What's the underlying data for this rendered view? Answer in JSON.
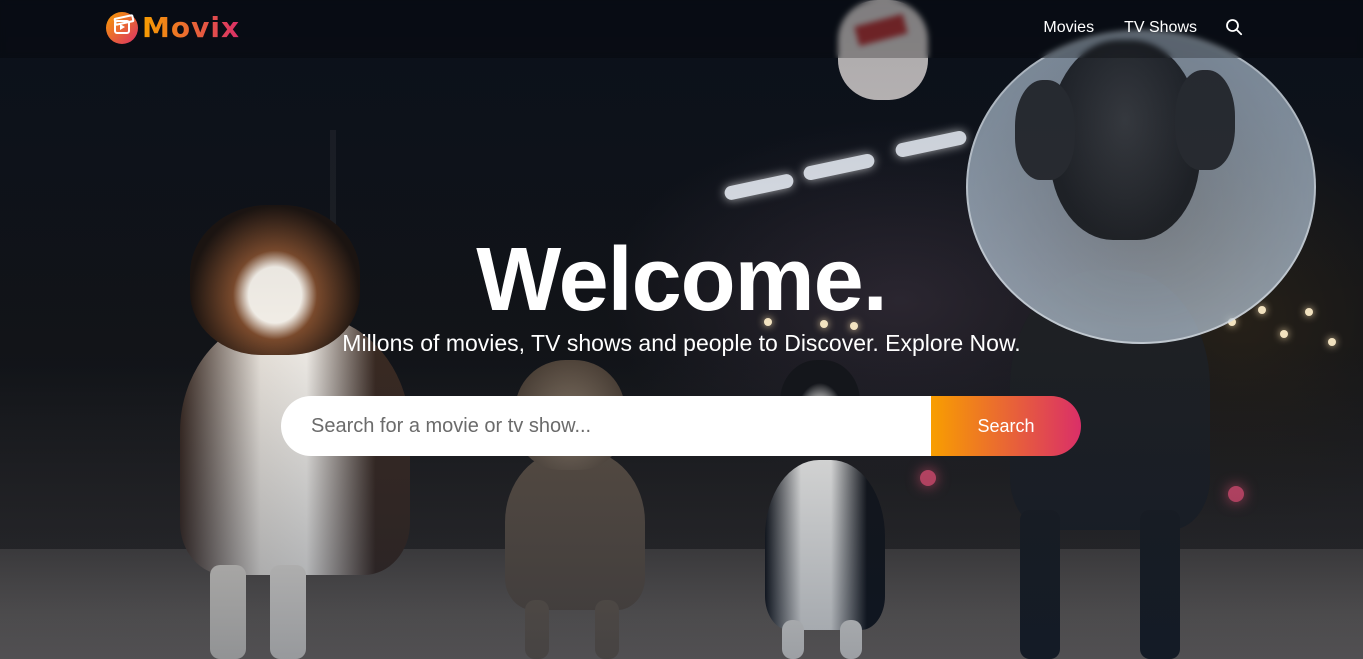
{
  "app": {
    "logo_text": "Movix"
  },
  "header": {
    "nav": [
      {
        "label": "Movies"
      },
      {
        "label": "TV Shows"
      }
    ]
  },
  "hero": {
    "title": "Welcome.",
    "subtitle": "Millons of movies, TV shows and people to Discover. Explore Now.",
    "background_image": "dogs-night-street-backdrop",
    "search": {
      "value": "",
      "placeholder": "Search for a movie or tv show...",
      "button_label": "Search"
    }
  },
  "colors": {
    "gradient_start": "#f89e00",
    "gradient_end": "#da2f68",
    "background": "#04152d",
    "text": "#ffffff"
  },
  "icons": {
    "logo": "clapperboard-play-icon",
    "search": "search-icon"
  }
}
